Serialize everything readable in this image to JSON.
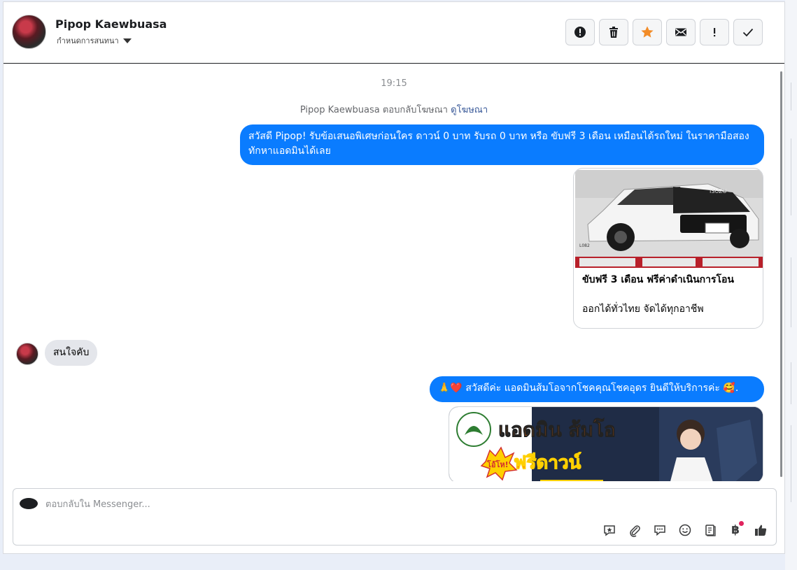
{
  "header": {
    "contact_name": "Pipop Kaewbuasa",
    "assign_label": "กำหนดการสนทนา",
    "tools": [
      {
        "icon": "alert-circle-icon",
        "name": "report-button"
      },
      {
        "icon": "trash-icon",
        "name": "delete-button"
      },
      {
        "icon": "star-icon",
        "name": "star-button"
      },
      {
        "icon": "envelope-icon",
        "name": "mark-unread-button"
      },
      {
        "icon": "exclamation-icon",
        "name": "spam-button"
      },
      {
        "icon": "check-icon",
        "name": "done-button"
      }
    ]
  },
  "thread": {
    "timestamp": "19:15",
    "ad_reply_text": "Pipop Kaewbuasa ตอบกลับโฆษณา",
    "ad_link": "ดูโฆษณา",
    "messages": [
      {
        "direction": "out",
        "text": "สวัสดี Pipop! รับข้อเสนอพิเศษก่อนใคร ดาวน์ 0 บาท รับรถ 0 บาท หรือ ขับฟรี 3 เดือน เหมือนได้รถใหม่ ในราคามือสอง ทักหาแอดมินได้เลย"
      },
      {
        "direction": "in",
        "text": "สนใจคับ"
      },
      {
        "direction": "out",
        "text": "🙏❤️ สวัสดีค่ะ แอดมินส้มโอจากโชคคุณโชคอุดร ยินดีให้บริการค่ะ 🥰."
      }
    ],
    "card": {
      "title": "ขับฟรี 3 เดือน ฟรีค่าดำเนินการโอน",
      "description": "ออกได้ทั่วไทย จัดได้ทุกอาชีพ",
      "image_brand": "ISUZU",
      "image_code": "L082"
    },
    "banner": {
      "headline": "แอดมิน ส้มโอ",
      "promo": "ฟรีดาวน์",
      "badge": "โอ้โห!"
    }
  },
  "composer": {
    "placeholder": "ตอบกลับใน Messenger...",
    "value": "",
    "tools": [
      "saved-reply-icon",
      "attach-icon",
      "chat-bubble-icon",
      "emoji-icon",
      "notes-icon",
      "baht-icon",
      "like-icon"
    ],
    "baht_symbol": "฿"
  },
  "colors": {
    "accent": "#0a7cff",
    "star": "#f28c28",
    "incoming_bubble": "#e4e6eb",
    "notification_dot": "#e0245e"
  }
}
